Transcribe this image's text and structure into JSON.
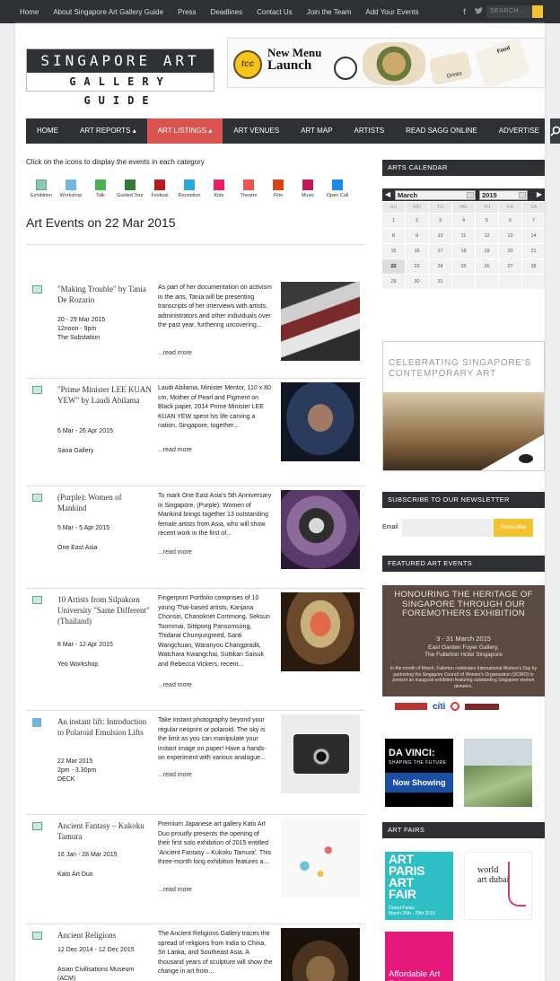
{
  "topbar": {
    "links": [
      "Home",
      "About Singapore Art Gallery Guide",
      "Press",
      "Deadlines",
      "Contact Us",
      "Join the Team",
      "Add Your Events"
    ],
    "search_placeholder": "SEARCH..."
  },
  "logo": {
    "line1": "SINGAPORE ART",
    "line2": "GALLERY GUIDE"
  },
  "banner": {
    "brand": "tcc",
    "line1": "New Menu",
    "line2": "Launch",
    "tags": [
      "Drinks",
      "Food"
    ]
  },
  "nav": {
    "items": [
      "HOME",
      "ART REPORTS",
      "ART LISTINGS",
      "ART VENUES",
      "ART MAP",
      "ARTISTS",
      "READ SAGG ONLINE",
      "ADVERTISE"
    ],
    "active_index": 2
  },
  "categories": {
    "hint": "Click on the icons to display the events in each category",
    "items": [
      {
        "label": "Exhibition",
        "color": "#8fc9a3",
        "icon": "picture-icon"
      },
      {
        "label": "Workshop",
        "color": "#6fb6e0",
        "icon": "brush-icon"
      },
      {
        "label": "Talk",
        "color": "#4caf50",
        "icon": "talk-icon"
      },
      {
        "label": "Guided Tour",
        "color": "#2e7d32",
        "icon": "map-icon"
      },
      {
        "label": "Festival",
        "color": "#b71c1c",
        "icon": "festival-icon"
      },
      {
        "label": "Reception",
        "color": "#29a7df",
        "icon": "reception-icon"
      },
      {
        "label": "Kids",
        "color": "#e91e63",
        "icon": "kids-icon"
      },
      {
        "label": "Theatre",
        "color": "#ef5350",
        "icon": "theatre-icon"
      },
      {
        "label": "Film",
        "color": "#d84315",
        "icon": "film-icon"
      },
      {
        "label": "Music",
        "color": "#c2185b",
        "icon": "music-icon"
      },
      {
        "label": "Open Call",
        "color": "#1e88e5",
        "icon": "open-call-icon"
      }
    ]
  },
  "events_heading": "Art Events on 22 Mar 2015",
  "read_more": "...read more",
  "events": [
    {
      "title": "\"Making Trouble\" by Tania De Rozario",
      "dates": "20 - 29 Mar 2015",
      "time": "12noon - 9pm",
      "venue": "The Substation",
      "desc": "As part of her documentation on activism in the arts, Tania will be presenting transcripts of her interviews with artists, administrators and other individuals over the past year, furthering uncovering..."
    },
    {
      "title": "\"Prime Minister LEE KUAN YEW\" by Laudi Abilama",
      "dates": "6 Mar - 26 Apr 2015",
      "time": "",
      "venue": "Sana Gallery",
      "desc": "Laudi Abilama, Minister Mentor, 110 x 80 cm, Mother of Pearl and Pigment on Black paper, 2014 Prime Minister LEE KUAN YEW spent his life carving a nation, Singapore, together..."
    },
    {
      "title": "(Purple): Women of Mankind",
      "dates": "5 Mar - 5 Apr 2015",
      "time": "",
      "venue": "One East Asia",
      "desc": "To mark One East Asia's 5th Anniversary in Singapore, (Purple): Women of Mankind brings together 13 outstanding female artists from Asia, who will show recent work in the first of..."
    },
    {
      "title": "10 Artists from Silpakorn University \"Same Different\" (Thailand)",
      "dates": "8 Mar - 12 Apr 2015",
      "time": "",
      "venue": "Yeo Workshop",
      "desc": "Fingerprint Portfolio comprises of 10 young Thai-based artists, Kanjana Chonsiri, Chanoknet Commong, Seksun Toommai, Sittipong Pansomsong, Thidarat Chumjungreed, Santi Wangchuan, Waranyou Changpradit, Watchara Kwangchai, Suttikan Saisuk and Rebecca Vickers, recent..."
    },
    {
      "title": "An instant lift: Introduction to Polaroid Emulsion Lifts",
      "dates": "22 Mar 2015",
      "time": "2pm - 3.30pm",
      "venue": "DECK",
      "desc": "Take instant photography beyond your regular neoprint or polaroid. The sky is the limit as you can manipulate your instant image on paper! Have a hands-on experiment with various analogue..."
    },
    {
      "title": "Ancient Fantasy – Kukoku Tamura",
      "dates": "16 Jan - 28 Mar 2015",
      "time": "",
      "venue": "Kato Art Duo",
      "desc": "Premium Japanese art gallery Kato Art Duo proudly presents the opening of their first solo exhibition of 2015 entitled 'Ancient Fantasy – Kukoku Tamura'. This three-month long exhibition features a..."
    },
    {
      "title": "Ancient Religions",
      "dates": "12 Dec 2014 - 12 Dec 2015",
      "time": "",
      "venue": "Asian Civilisations Museum (ACM)",
      "desc": "The Ancient Religions Gallery traces the spread of religions from India to China, Sri Lanka, and Southeast Asia. A thousand years of sculpture will show the change in art from..."
    }
  ],
  "sidebar": {
    "calendar_title": "ARTS CALENDAR",
    "month": "March",
    "year": "2015",
    "weekdays": [
      "SU",
      "MO",
      "TU",
      "WE",
      "TH",
      "FR",
      "SA"
    ],
    "days": [
      "1",
      "2",
      "3",
      "4",
      "5",
      "6",
      "7",
      "8",
      "9",
      "10",
      "11",
      "12",
      "13",
      "14",
      "15",
      "16",
      "17",
      "18",
      "19",
      "20",
      "21",
      "22",
      "23",
      "24",
      "25",
      "26",
      "27",
      "28",
      "29",
      "30",
      "31",
      "",
      "",
      "",
      ""
    ],
    "selected_day": "22",
    "ad_text": "CELEBRATING SINGAPORE'S CONTEMPORARY ART",
    "newsletter_title": "SUBSCRIBE TO OUR NEWSLETTER",
    "email_label": "Email",
    "subscribe_label": "Subscribe",
    "featured_title": "FEATURED ART EVENTS",
    "featured_heading": "HONOURING THE HERITAGE OF SINGAPORE THROUGH OUR FOREMOTHERS EXHIBITION",
    "featured_dates": "3 - 31 March 2015",
    "featured_venue1": "East Garden Foyer Gallery,",
    "featured_venue2": "The Fullerton Hotel Singapore",
    "featured_blurb": "In the month of March, Fullerton celebrates International Women's Day by partnering the Singapore Council of Women's Organisation (SCWO) to present an inaugural exhibition featuring outstanding Singapore women pioneers.",
    "sponsor_citi": "citi",
    "davinci_title": "DA VINCI:",
    "davinci_sub": "SHAPING THE FUTURE",
    "davinci_show": "Now Showing",
    "art_fairs_title": "ART FAIRS",
    "apaf_text": "ART PARIS ART FAIR",
    "apaf_sub1": "Grand Palais",
    "apaf_sub2": "March 26th - 29th 2015",
    "wad_text": "world art dubai",
    "aaf_text": "Affordable Art Fair"
  }
}
